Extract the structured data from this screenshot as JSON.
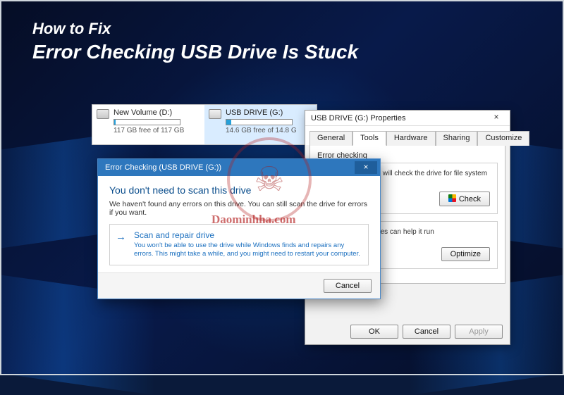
{
  "headline": {
    "line1": "How to Fix",
    "line2": "Error Checking USB Drive Is Stuck"
  },
  "drives": [
    {
      "label": "New Volume (D:)",
      "fill_pct": 2,
      "free": "117 GB free of 117 GB",
      "selected": false
    },
    {
      "label": "USB DRIVE (G:)",
      "fill_pct": 8,
      "free": "14.6 GB free of 14.8 G",
      "selected": true
    }
  ],
  "props": {
    "title": "USB DRIVE (G:) Properties",
    "close": "×",
    "tabs": [
      "General",
      "Tools",
      "Hardware",
      "Sharing",
      "Customize"
    ],
    "active_tab": 1,
    "error_checking": {
      "title": "Error checking",
      "desc": "This option will check the drive for file system errors.",
      "button": "Check"
    },
    "optimize": {
      "desc": "puter's drives can help it run",
      "button": "Optimize"
    },
    "buttons": {
      "ok": "OK",
      "cancel": "Cancel",
      "apply": "Apply"
    }
  },
  "chk": {
    "title": "Error Checking (USB DRIVE (G:))",
    "close": "×",
    "heading": "You don't need to scan this drive",
    "sub": "We haven't found any errors on this drive. You can still scan the drive for errors if you want.",
    "option": {
      "title": "Scan and repair drive",
      "desc": "You won't be able to use the drive while Windows finds and repairs any errors. This might take a while, and you might need to restart your computer."
    },
    "cancel": "Cancel"
  },
  "watermark": "Daominhha.com"
}
